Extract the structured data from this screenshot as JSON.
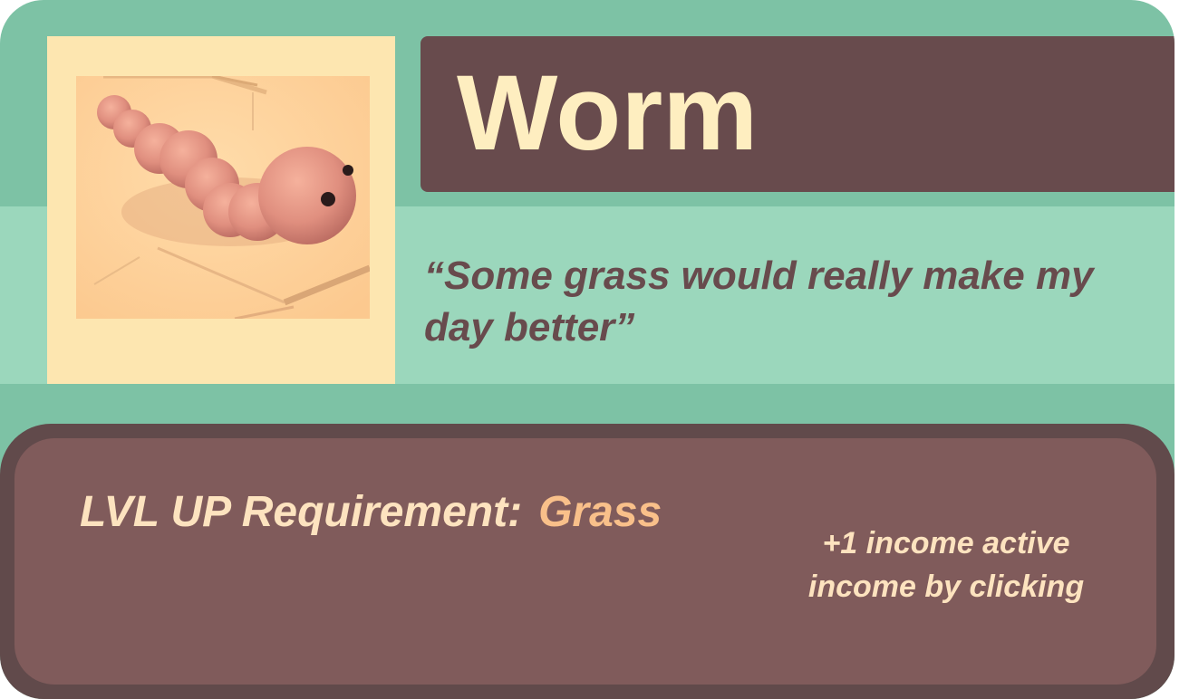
{
  "card": {
    "name": "Worm",
    "quote": "“Some grass would really make my day better”",
    "portrait_icon": "worm-icon",
    "requirement_label": "LVL UP Requirement:",
    "requirement_value": "Grass",
    "effect": "+1 income active income by clicking"
  },
  "colors": {
    "card_green": "#7dc2a5",
    "band_green": "#9bd7bc",
    "portrait_bg": "#fde6b0",
    "name_plate": "#684b4d",
    "name_text": "#feeec0",
    "panel_outer": "#614a4b",
    "panel_inner": "#805b5b",
    "panel_text": "#fde3bf",
    "accent_orange": "#f9c08a"
  }
}
